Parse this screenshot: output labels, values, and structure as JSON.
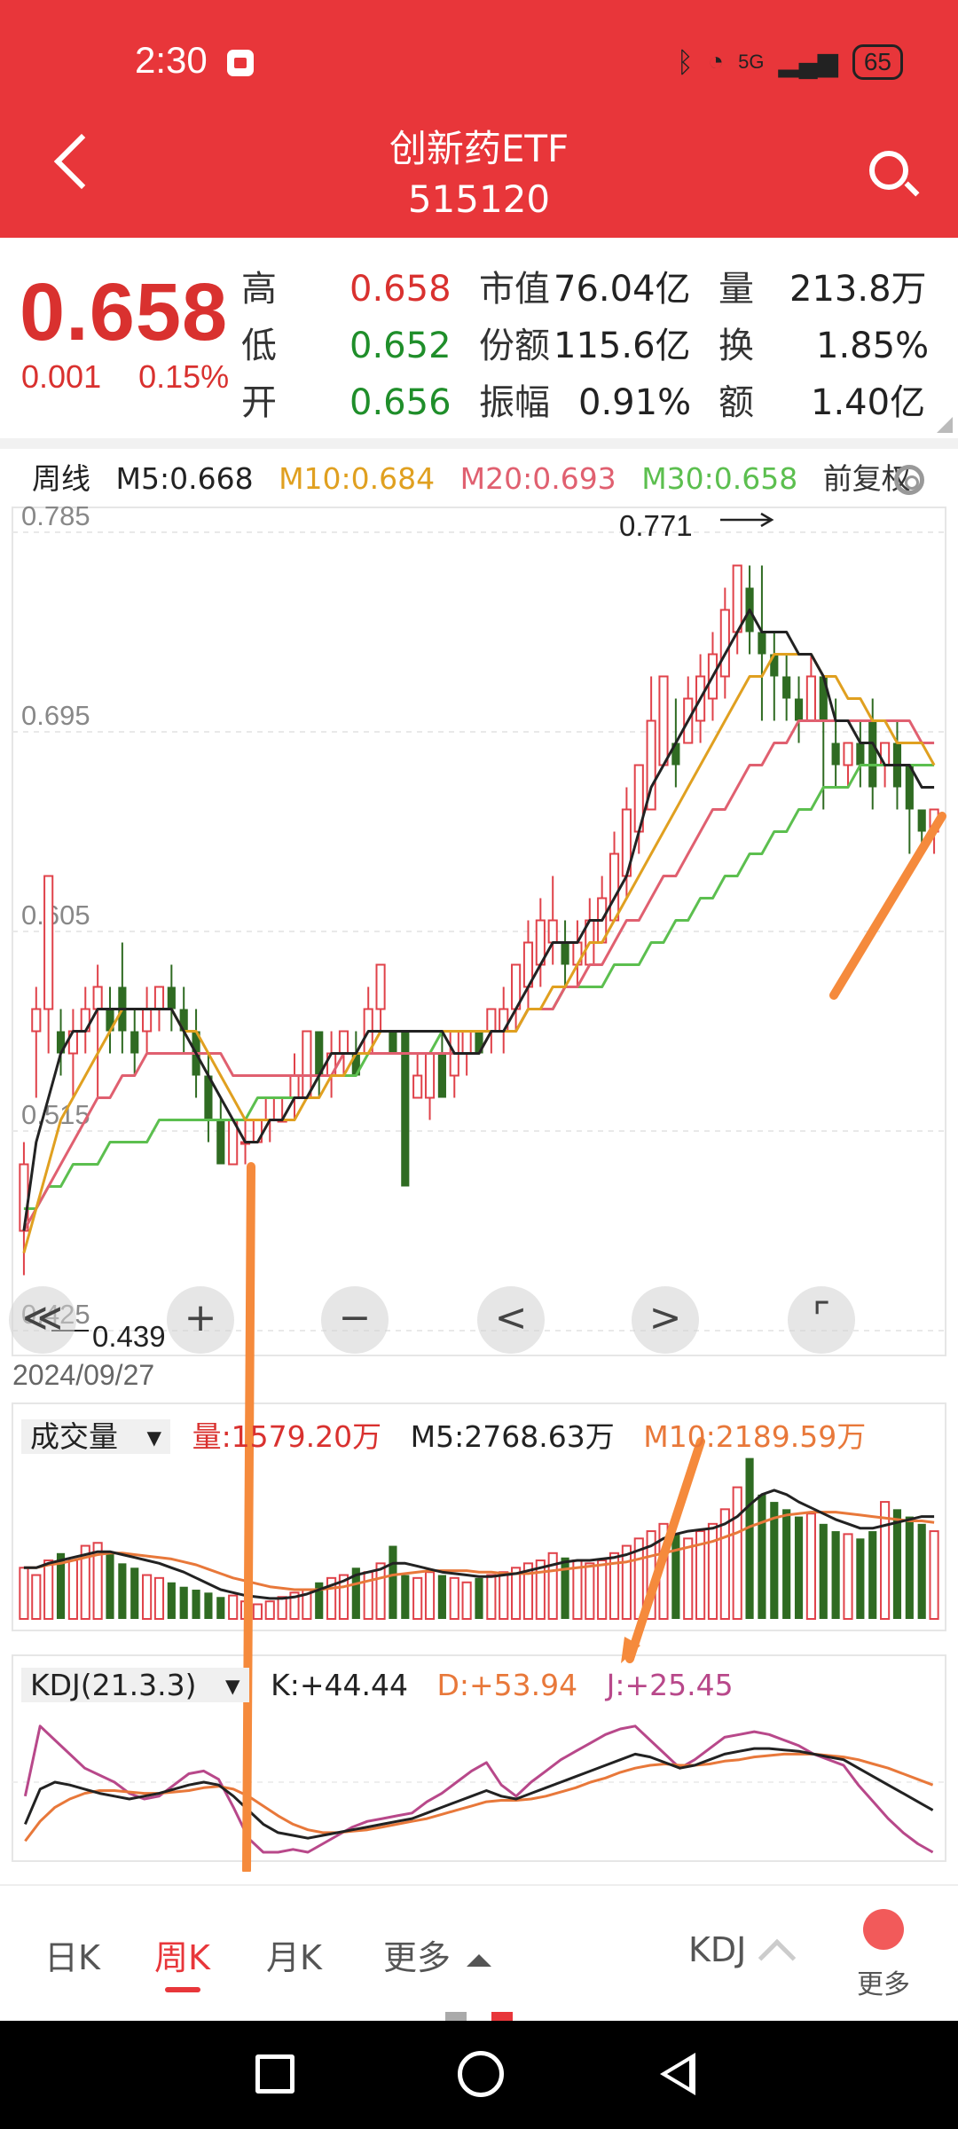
{
  "status_bar": {
    "time": "2:30",
    "network": "5G",
    "battery": "65"
  },
  "header": {
    "title": "创新药ETF",
    "code": "515120"
  },
  "quote": {
    "price": "0.658",
    "change": "0.001",
    "change_pct": "0.15%",
    "stats": [
      {
        "label": "高",
        "value": "0.658",
        "color": "#d9312f"
      },
      {
        "label": "低",
        "value": "0.652",
        "color": "#1f8e2a"
      },
      {
        "label": "开",
        "value": "0.656",
        "color": "#1f8e2a"
      },
      {
        "label": "市值",
        "value": "76.04亿"
      },
      {
        "label": "份额",
        "value": "115.6亿"
      },
      {
        "label": "振幅",
        "value": "0.91%"
      },
      {
        "label": "量",
        "value": "213.8万"
      },
      {
        "label": "换",
        "value": "1.85%"
      },
      {
        "label": "额",
        "value": "1.40亿"
      }
    ]
  },
  "legend": {
    "period": "周线",
    "ma5": "M5:0.668",
    "ma10": "M10:0.684",
    "ma20": "M20:0.693",
    "ma30": "M30:0.658",
    "adjust": "前复权",
    "colors": {
      "ma5": "#222222",
      "ma10": "#e0a020",
      "ma20": "#e06070",
      "ma30": "#5cbf4f"
    }
  },
  "chart_data": [
    {
      "type": "candlestick",
      "y_ticks": [
        "0.785",
        "0.695",
        "0.605",
        "0.515",
        "0.425"
      ],
      "ylim": [
        0.425,
        0.785
      ],
      "high_label": "0.771",
      "low_label": "0.439",
      "start_date": "2024/09/27",
      "candles": [
        [
          0.47,
          0.5,
          0.45,
          0.51
        ],
        [
          0.56,
          0.57,
          0.53,
          0.58
        ],
        [
          0.57,
          0.63,
          0.55,
          0.63
        ],
        [
          0.56,
          0.55,
          0.54,
          0.57
        ],
        [
          0.55,
          0.56,
          0.53,
          0.57
        ],
        [
          0.56,
          0.57,
          0.55,
          0.58
        ],
        [
          0.57,
          0.58,
          0.53,
          0.59
        ],
        [
          0.57,
          0.56,
          0.55,
          0.58
        ],
        [
          0.58,
          0.56,
          0.55,
          0.6
        ],
        [
          0.56,
          0.55,
          0.54,
          0.57
        ],
        [
          0.56,
          0.57,
          0.55,
          0.58
        ],
        [
          0.57,
          0.58,
          0.56,
          0.58
        ],
        [
          0.58,
          0.57,
          0.56,
          0.59
        ],
        [
          0.57,
          0.56,
          0.55,
          0.58
        ],
        [
          0.56,
          0.54,
          0.53,
          0.57
        ],
        [
          0.54,
          0.52,
          0.51,
          0.55
        ],
        [
          0.52,
          0.5,
          0.5,
          0.53
        ],
        [
          0.5,
          0.52,
          0.5,
          0.52
        ],
        [
          0.51,
          0.51,
          0.5,
          0.52
        ],
        [
          0.51,
          0.52,
          0.51,
          0.52
        ],
        [
          0.52,
          0.53,
          0.51,
          0.53
        ],
        [
          0.52,
          0.52,
          0.52,
          0.53
        ],
        [
          0.53,
          0.54,
          0.52,
          0.55
        ],
        [
          0.53,
          0.56,
          0.53,
          0.56
        ],
        [
          0.56,
          0.54,
          0.53,
          0.56
        ],
        [
          0.54,
          0.55,
          0.53,
          0.56
        ],
        [
          0.55,
          0.56,
          0.54,
          0.56
        ],
        [
          0.55,
          0.54,
          0.54,
          0.56
        ],
        [
          0.55,
          0.57,
          0.55,
          0.58
        ],
        [
          0.57,
          0.59,
          0.56,
          0.59
        ],
        [
          0.56,
          0.55,
          0.55,
          0.56
        ],
        [
          0.56,
          0.49,
          0.49,
          0.56
        ],
        [
          0.53,
          0.54,
          0.53,
          0.55
        ],
        [
          0.53,
          0.55,
          0.52,
          0.55
        ],
        [
          0.55,
          0.53,
          0.53,
          0.56
        ],
        [
          0.54,
          0.56,
          0.53,
          0.56
        ],
        [
          0.55,
          0.56,
          0.54,
          0.56
        ],
        [
          0.56,
          0.55,
          0.55,
          0.56
        ],
        [
          0.56,
          0.57,
          0.55,
          0.57
        ],
        [
          0.56,
          0.57,
          0.55,
          0.58
        ],
        [
          0.57,
          0.59,
          0.56,
          0.59
        ],
        [
          0.58,
          0.6,
          0.57,
          0.61
        ],
        [
          0.59,
          0.61,
          0.58,
          0.62
        ],
        [
          0.6,
          0.61,
          0.59,
          0.63
        ],
        [
          0.6,
          0.59,
          0.58,
          0.61
        ],
        [
          0.59,
          0.6,
          0.58,
          0.61
        ],
        [
          0.59,
          0.61,
          0.59,
          0.62
        ],
        [
          0.6,
          0.62,
          0.6,
          0.63
        ],
        [
          0.61,
          0.64,
          0.61,
          0.65
        ],
        [
          0.63,
          0.66,
          0.62,
          0.67
        ],
        [
          0.65,
          0.68,
          0.64,
          0.68
        ],
        [
          0.66,
          0.7,
          0.66,
          0.72
        ],
        [
          0.68,
          0.72,
          0.68,
          0.72
        ],
        [
          0.69,
          0.68,
          0.67,
          0.71
        ],
        [
          0.69,
          0.71,
          0.69,
          0.72
        ],
        [
          0.7,
          0.72,
          0.69,
          0.73
        ],
        [
          0.71,
          0.73,
          0.7,
          0.74
        ],
        [
          0.72,
          0.75,
          0.71,
          0.76
        ],
        [
          0.74,
          0.77,
          0.73,
          0.77
        ],
        [
          0.76,
          0.74,
          0.73,
          0.77
        ],
        [
          0.74,
          0.73,
          0.7,
          0.77
        ],
        [
          0.73,
          0.72,
          0.7,
          0.74
        ],
        [
          0.72,
          0.71,
          0.7,
          0.73
        ],
        [
          0.71,
          0.7,
          0.69,
          0.72
        ],
        [
          0.7,
          0.72,
          0.7,
          0.73
        ],
        [
          0.72,
          0.7,
          0.66,
          0.72
        ],
        [
          0.69,
          0.68,
          0.67,
          0.71
        ],
        [
          0.68,
          0.69,
          0.67,
          0.69
        ],
        [
          0.69,
          0.68,
          0.67,
          0.7
        ],
        [
          0.7,
          0.67,
          0.66,
          0.71
        ],
        [
          0.68,
          0.69,
          0.67,
          0.69
        ],
        [
          0.69,
          0.67,
          0.66,
          0.7
        ],
        [
          0.68,
          0.66,
          0.64,
          0.68
        ],
        [
          0.66,
          0.65,
          0.64,
          0.66
        ],
        [
          0.65,
          0.66,
          0.64,
          0.66
        ]
      ],
      "ma5": [
        0.47,
        0.51,
        0.53,
        0.55,
        0.56,
        0.56,
        0.57,
        0.57,
        0.57,
        0.57,
        0.57,
        0.57,
        0.57,
        0.56,
        0.55,
        0.54,
        0.53,
        0.52,
        0.51,
        0.51,
        0.52,
        0.52,
        0.53,
        0.53,
        0.54,
        0.55,
        0.55,
        0.55,
        0.56,
        0.56,
        0.56,
        0.56,
        0.56,
        0.56,
        0.56,
        0.55,
        0.55,
        0.55,
        0.56,
        0.56,
        0.57,
        0.58,
        0.59,
        0.6,
        0.6,
        0.6,
        0.61,
        0.61,
        0.62,
        0.63,
        0.65,
        0.67,
        0.68,
        0.69,
        0.7,
        0.71,
        0.72,
        0.73,
        0.74,
        0.75,
        0.74,
        0.74,
        0.74,
        0.73,
        0.73,
        0.72,
        0.7,
        0.7,
        0.69,
        0.69,
        0.68,
        0.68,
        0.68,
        0.67,
        0.67
      ],
      "ma10": [
        0.46,
        0.48,
        0.5,
        0.52,
        0.53,
        0.54,
        0.55,
        0.56,
        0.57,
        0.57,
        0.57,
        0.57,
        0.57,
        0.56,
        0.56,
        0.55,
        0.54,
        0.53,
        0.52,
        0.52,
        0.52,
        0.52,
        0.52,
        0.53,
        0.53,
        0.54,
        0.54,
        0.55,
        0.55,
        0.56,
        0.56,
        0.56,
        0.56,
        0.56,
        0.56,
        0.56,
        0.56,
        0.56,
        0.56,
        0.56,
        0.56,
        0.57,
        0.57,
        0.58,
        0.58,
        0.59,
        0.6,
        0.6,
        0.61,
        0.62,
        0.63,
        0.64,
        0.65,
        0.66,
        0.67,
        0.68,
        0.69,
        0.7,
        0.71,
        0.72,
        0.72,
        0.73,
        0.73,
        0.73,
        0.73,
        0.72,
        0.72,
        0.71,
        0.71,
        0.7,
        0.7,
        0.69,
        0.69,
        0.69,
        0.68
      ],
      "ma20": [
        0.47,
        0.48,
        0.49,
        0.5,
        0.51,
        0.52,
        0.53,
        0.53,
        0.54,
        0.54,
        0.55,
        0.55,
        0.55,
        0.55,
        0.55,
        0.55,
        0.55,
        0.54,
        0.54,
        0.54,
        0.54,
        0.54,
        0.54,
        0.54,
        0.54,
        0.54,
        0.55,
        0.55,
        0.55,
        0.55,
        0.55,
        0.55,
        0.55,
        0.55,
        0.55,
        0.55,
        0.55,
        0.55,
        0.56,
        0.56,
        0.56,
        0.57,
        0.57,
        0.57,
        0.58,
        0.58,
        0.59,
        0.59,
        0.6,
        0.61,
        0.61,
        0.62,
        0.63,
        0.63,
        0.64,
        0.65,
        0.66,
        0.66,
        0.67,
        0.68,
        0.68,
        0.69,
        0.69,
        0.7,
        0.7,
        0.7,
        0.7,
        0.7,
        0.7,
        0.7,
        0.7,
        0.7,
        0.7,
        0.69,
        0.69
      ],
      "ma30": [
        0.48,
        0.48,
        0.49,
        0.49,
        0.5,
        0.5,
        0.5,
        0.51,
        0.51,
        0.51,
        0.51,
        0.52,
        0.52,
        0.52,
        0.52,
        0.52,
        0.52,
        0.52,
        0.52,
        0.53,
        0.53,
        0.53,
        0.53,
        0.53,
        0.54,
        0.54,
        0.54,
        0.54,
        0.55,
        0.55,
        0.55,
        0.55,
        0.55,
        0.55,
        0.56,
        0.56,
        0.56,
        0.56,
        0.56,
        0.56,
        0.56,
        0.57,
        0.57,
        0.57,
        0.58,
        0.58,
        0.58,
        0.58,
        0.59,
        0.59,
        0.59,
        0.6,
        0.6,
        0.61,
        0.61,
        0.62,
        0.62,
        0.63,
        0.63,
        0.64,
        0.64,
        0.65,
        0.65,
        0.66,
        0.66,
        0.67,
        0.67,
        0.67,
        0.68,
        0.68,
        0.68,
        0.68,
        0.68,
        0.68,
        0.68
      ]
    },
    {
      "type": "bar",
      "name": "成交量",
      "legend_vol": "量:1579.20万",
      "legend_m5": "M5:2768.63万",
      "legend_m10": "M10:2189.59万",
      "values": [
        35,
        30,
        40,
        45,
        40,
        50,
        52,
        45,
        38,
        35,
        30,
        28,
        25,
        22,
        20,
        18,
        15,
        16,
        12,
        10,
        12,
        15,
        18,
        20,
        25,
        28,
        30,
        35,
        32,
        38,
        50,
        30,
        28,
        32,
        30,
        28,
        25,
        28,
        30,
        32,
        35,
        38,
        40,
        45,
        42,
        40,
        38,
        40,
        45,
        50,
        55,
        60,
        65,
        58,
        55,
        60,
        65,
        75,
        90,
        110,
        85,
        80,
        75,
        70,
        72,
        65,
        60,
        58,
        55,
        60,
        80,
        75,
        70,
        65,
        60
      ],
      "ma5": [
        35,
        35,
        38,
        40,
        42,
        44,
        46,
        46,
        44,
        42,
        40,
        38,
        35,
        32,
        28,
        24,
        20,
        18,
        16,
        15,
        14,
        14,
        15,
        17,
        20,
        23,
        26,
        30,
        32,
        34,
        38,
        38,
        36,
        34,
        32,
        31,
        30,
        29,
        29,
        30,
        31,
        33,
        35,
        37,
        39,
        40,
        40,
        41,
        42,
        44,
        47,
        50,
        55,
        58,
        60,
        61,
        62,
        65,
        70,
        78,
        85,
        88,
        85,
        80,
        76,
        72,
        68,
        65,
        62,
        62,
        64,
        66,
        68,
        70,
        70
      ],
      "ma10": [
        35,
        35,
        37,
        38,
        40,
        42,
        44,
        45,
        45,
        44,
        43,
        42,
        41,
        39,
        37,
        34,
        31,
        28,
        26,
        24,
        22,
        21,
        20,
        20,
        20,
        21,
        22,
        24,
        26,
        28,
        30,
        31,
        32,
        33,
        33,
        33,
        33,
        32,
        32,
        31,
        31,
        31,
        32,
        33,
        34,
        35,
        36,
        37,
        38,
        39,
        41,
        43,
        45,
        47,
        49,
        51,
        53,
        56,
        59,
        63,
        66,
        69,
        71,
        72,
        73,
        73,
        73,
        72,
        71,
        70,
        69,
        68,
        67,
        67,
        66
      ]
    },
    {
      "type": "line",
      "name": "KDJ",
      "params": "KDJ(21.3.3)",
      "legend_k": "K:+44.44",
      "legend_d": "D:+53.94",
      "legend_j": "J:+25.45",
      "k": [
        20,
        45,
        50,
        48,
        45,
        42,
        40,
        38,
        40,
        42,
        45,
        48,
        50,
        48,
        40,
        30,
        20,
        14,
        12,
        10,
        12,
        14,
        16,
        18,
        20,
        22,
        24,
        28,
        32,
        36,
        40,
        44,
        40,
        38,
        42,
        46,
        50,
        54,
        58,
        62,
        66,
        70,
        68,
        64,
        60,
        62,
        66,
        70,
        72,
        74,
        74,
        73,
        72,
        70,
        68,
        66,
        60,
        54,
        48,
        42,
        36,
        30
      ],
      "d": [
        8,
        22,
        32,
        38,
        42,
        44,
        44,
        43,
        42,
        42,
        43,
        44,
        46,
        47,
        45,
        40,
        33,
        26,
        20,
        16,
        14,
        14,
        15,
        16,
        18,
        20,
        22,
        24,
        27,
        30,
        33,
        36,
        37,
        37,
        38,
        40,
        43,
        46,
        50,
        53,
        57,
        60,
        62,
        63,
        62,
        62,
        63,
        65,
        66,
        68,
        69,
        70,
        70,
        70,
        69,
        68,
        66,
        63,
        60,
        56,
        52,
        48
      ],
      "j": [
        40,
        90,
        80,
        70,
        60,
        55,
        50,
        42,
        38,
        40,
        48,
        56,
        58,
        52,
        32,
        10,
        0,
        0,
        2,
        0,
        6,
        12,
        18,
        22,
        24,
        26,
        28,
        36,
        42,
        50,
        58,
        64,
        48,
        40,
        50,
        58,
        66,
        72,
        78,
        84,
        88,
        90,
        80,
        70,
        60,
        66,
        74,
        82,
        84,
        86,
        84,
        80,
        76,
        70,
        66,
        62,
        48,
        36,
        24,
        14,
        6,
        0
      ]
    }
  ],
  "controls": {
    "first": "≪",
    "zoom_in": "+",
    "zoom_out": "−",
    "prev": "<",
    "next": ">",
    "fullscreen": "⌜"
  },
  "bottom_tabs": {
    "day": "日K",
    "week": "周K",
    "month": "月K",
    "more": "更多",
    "indicator": "KDJ",
    "more_btn": "更多"
  }
}
